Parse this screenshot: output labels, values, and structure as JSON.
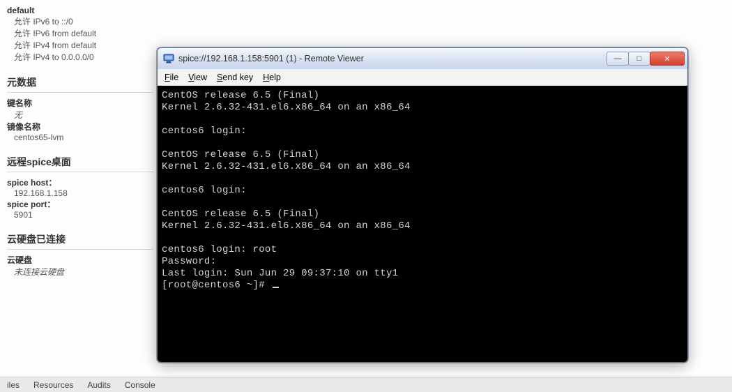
{
  "firewall": {
    "title": "default",
    "rules": [
      "允许 IPv6 to ::/0",
      "允许 IPv6 from default",
      "允许 IPv4 from default",
      "允许 IPv4 to 0.0.0.0/0"
    ]
  },
  "metadata": {
    "heading": "元数据",
    "keypair_label": "键名称",
    "keypair_value": "无",
    "image_label": "镜像名称",
    "image_value": "centos65-lvm"
  },
  "spice": {
    "heading": "远程spice桌面",
    "host_label": "spice host：",
    "host_value": "192.168.1.158",
    "port_label": "spice port：",
    "port_value": "5901"
  },
  "volumes": {
    "heading": "云硬盘已连接",
    "label": "云硬盘",
    "value": "未连接云硬盘"
  },
  "devtabs": [
    "iles",
    "Resources",
    "Audits",
    "Console"
  ],
  "window": {
    "title": "spice://192.168.1.158:5901 (1) - Remote Viewer",
    "menus": {
      "file": "File",
      "view": "View",
      "sendkey": "Send key",
      "help": "Help"
    },
    "buttons": {
      "min": "—",
      "max": "□",
      "close": "✕"
    },
    "terminal_lines": [
      "CentOS release 6.5 (Final)",
      "Kernel 2.6.32-431.el6.x86_64 on an x86_64",
      "",
      "centos6 login:",
      "",
      "CentOS release 6.5 (Final)",
      "Kernel 2.6.32-431.el6.x86_64 on an x86_64",
      "",
      "centos6 login:",
      "",
      "CentOS release 6.5 (Final)",
      "Kernel 2.6.32-431.el6.x86_64 on an x86_64",
      "",
      "centos6 login: root",
      "Password:",
      "Last login: Sun Jun 29 09:37:10 on tty1",
      "[root@centos6 ~]# "
    ]
  }
}
